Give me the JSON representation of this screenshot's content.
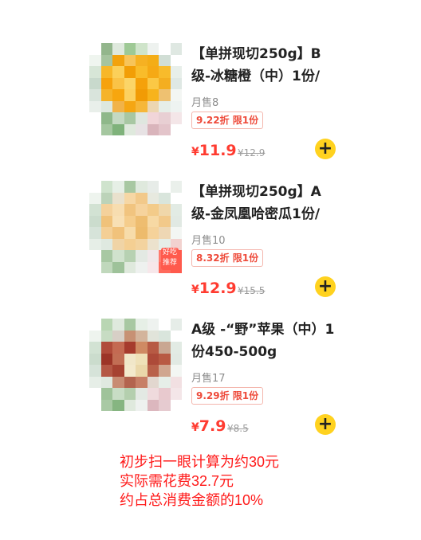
{
  "products": [
    {
      "name": "【单拼现切250g】B级-冰糖橙（中）1份/",
      "sales": "月售8",
      "promo": "9.22折 限1份",
      "currency": "¥",
      "price": "11.9",
      "original_price": "¥12.9",
      "add_icon": "+"
    },
    {
      "name": "【单拼现切250g】A级-金凤凰哈密瓜1份/",
      "sales": "月售10",
      "promo": "8.32折 限1份",
      "currency": "¥",
      "price": "12.9",
      "original_price": "¥15.5",
      "add_icon": "+",
      "badge": "好吃推荐"
    },
    {
      "name": "A级 -“野”苹果（中）1份450-500g",
      "sales": "月售17",
      "promo": "9.29折 限1份",
      "currency": "¥",
      "price": "7.9",
      "original_price": "¥8.5",
      "add_icon": "+"
    }
  ],
  "annotation": {
    "line1": "初步扫一眼计算为约30元",
    "line2": "实际需花费32.7元",
    "line3": "约占总消费金额的10%"
  },
  "colors": {
    "price": "#ff3b30",
    "promo_border": "#f4b6ad",
    "add_button": "#ffd21f",
    "annotation": "#ff1a1a"
  }
}
